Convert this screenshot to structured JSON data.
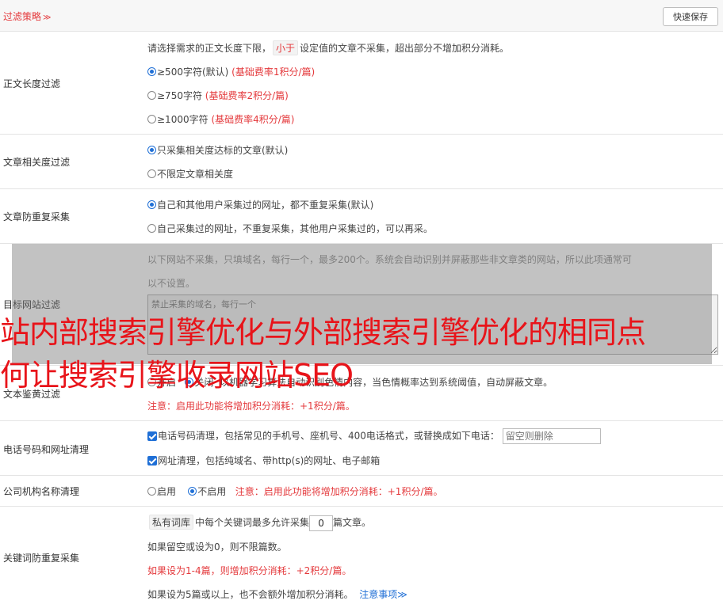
{
  "header": {
    "title": "过滤策略",
    "save_label": "快速保存"
  },
  "length_filter": {
    "label": "正文长度过滤",
    "desc_pre": "请选择需求的正文长度下限，",
    "desc_tag": "小于",
    "desc_post": "设定值的文章不采集，超出部分不增加积分消耗。",
    "options": [
      {
        "label": "≥500字符(默认)",
        "note": "(基础费率1积分/篇)",
        "selected": true
      },
      {
        "label": "≥750字符",
        "note": "(基础费率2积分/篇)",
        "selected": false
      },
      {
        "label": "≥1000字符",
        "note": "(基础费率4积分/篇)",
        "selected": false
      }
    ]
  },
  "relevance_filter": {
    "label": "文章相关度过滤",
    "options": [
      {
        "label": "只采集相关度达标的文章(默认)",
        "selected": true
      },
      {
        "label": "不限定文章相关度",
        "selected": false
      }
    ]
  },
  "dup_filter": {
    "label": "文章防重复采集",
    "options": [
      {
        "label": "自己和其他用户采集过的网址，都不重复采集(默认)",
        "selected": true
      },
      {
        "label": "自己采集过的网址，不重复采集，其他用户采集过的，可以再采。",
        "selected": false
      }
    ]
  },
  "site_filter": {
    "label": "目标网站过滤",
    "desc_line1": "以下网站不采集，只填域名，每行一个，最多200个。系统会自动识别并屏蔽那些非文章类的网站，所以此项通常可",
    "desc_line2": "以不设置。",
    "placeholder": "禁止采集的域名，每行一个"
  },
  "porn_filter": {
    "label": "文本鉴黄过滤",
    "option_on": "开启",
    "option_off": "关闭",
    "desc": "以机器学习算法自动识别色情内容，当色情概率达到系统阈值，自动屏蔽文章。",
    "note": "注意：启用此功能将增加积分消耗：+1积分/篇。"
  },
  "phone_filter": {
    "label": "电话号码和网址清理",
    "phone_text": "电话号码清理，包括常见的手机号、座机号、400电话格式，或替换成如下电话：",
    "phone_placeholder": "留空则删除",
    "url_text": "网址清理，包括纯域名、带http(s)的网址、电子邮箱"
  },
  "org_filter": {
    "label": "公司机构名称清理",
    "option_on": "启用",
    "option_off": "不启用",
    "note": "注意：启用此功能将增加积分消耗：+1积分/篇。"
  },
  "keyword_filter": {
    "label": "关键词防重复采集",
    "tag": "私有词库",
    "line1_mid": "中每个关键词最多允许采集",
    "value": "0",
    "line1_post": "篇文章。",
    "line2": "如果留空或设为0，则不限篇数。",
    "line3": "如果设为1-4篇，则增加积分消耗：+2积分/篇。",
    "line4": "如果设为5篇或以上，也不会额外增加积分消耗。",
    "link": "注意事项"
  },
  "overlay": {
    "line1": "站内部搜索引擎优化与外部搜索引擎优化的相同点",
    "line2": "何让搜索引擎收录网站SEO"
  },
  "colors": {
    "accent": "#e4393c",
    "link": "#1f6fd6"
  }
}
